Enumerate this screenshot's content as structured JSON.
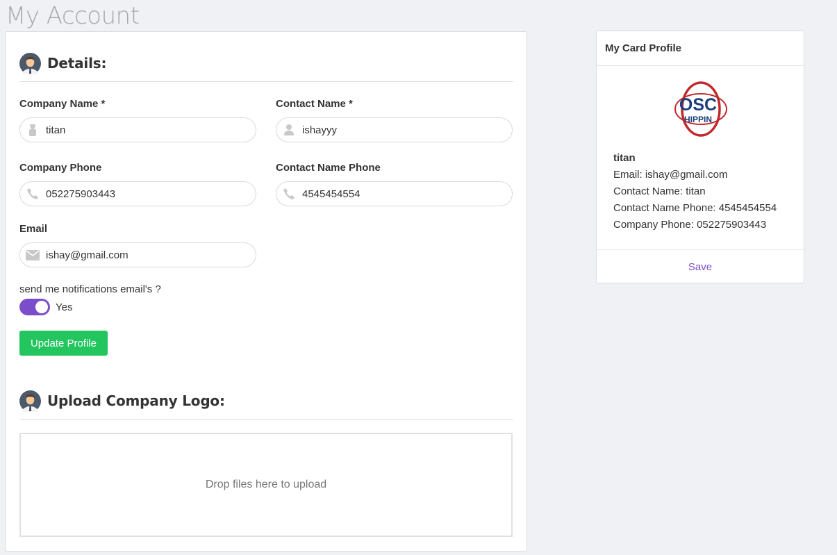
{
  "page": {
    "title": "My Account"
  },
  "details": {
    "heading": "Details:",
    "company_name": {
      "label": "Company Name *",
      "value": "titan"
    },
    "contact_name": {
      "label": "Contact Name *",
      "value": "ishayyy"
    },
    "company_phone": {
      "label": "Company Phone",
      "value": "052275903443"
    },
    "contact_phone": {
      "label": "Contact Name Phone",
      "value": "4545454554"
    },
    "email": {
      "label": "Email",
      "value": "ishay@gmail.com"
    },
    "notifications": {
      "label": "send me notifications email's ?",
      "toggle_text": "Yes",
      "enabled": true
    },
    "update_button": "Update Profile"
  },
  "upload": {
    "heading": "Upload Company Logo:",
    "dropzone_text": "Drop files here to upload"
  },
  "card_profile": {
    "title": "My Card Profile",
    "name": "titan",
    "email_line": "Email: ishay@gmail.com",
    "contact_name_line": "Contact Name: titan",
    "contact_phone_line": "Contact Name Phone: 4545454554",
    "company_phone_line": "Company Phone: 052275903443",
    "save_button": "Save"
  },
  "colors": {
    "accent": "#7a4ecb",
    "success": "#22c55e",
    "background": "#f0f1f5"
  }
}
